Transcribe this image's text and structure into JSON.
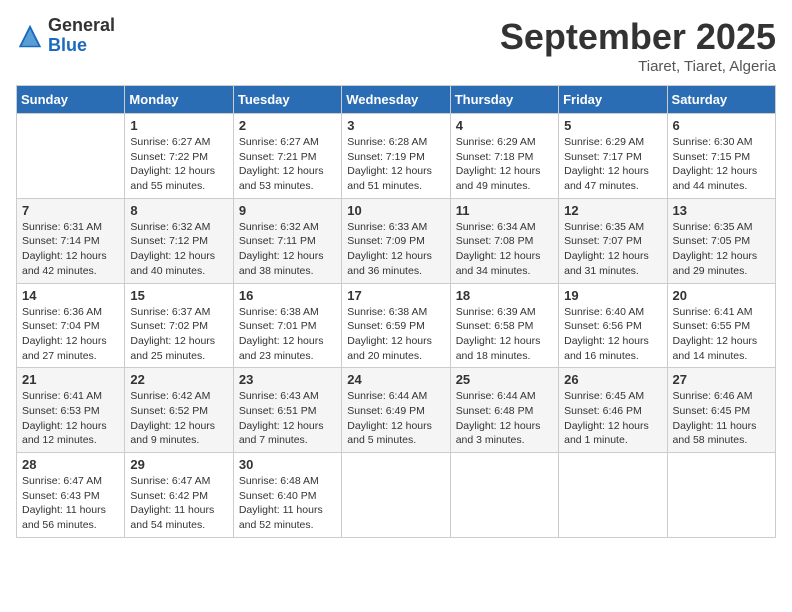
{
  "logo": {
    "general": "General",
    "blue": "Blue"
  },
  "title": "September 2025",
  "subtitle": "Tiaret, Tiaret, Algeria",
  "days_of_week": [
    "Sunday",
    "Monday",
    "Tuesday",
    "Wednesday",
    "Thursday",
    "Friday",
    "Saturday"
  ],
  "weeks": [
    [
      {
        "day": "",
        "info": ""
      },
      {
        "day": "1",
        "info": "Sunrise: 6:27 AM\nSunset: 7:22 PM\nDaylight: 12 hours\nand 55 minutes."
      },
      {
        "day": "2",
        "info": "Sunrise: 6:27 AM\nSunset: 7:21 PM\nDaylight: 12 hours\nand 53 minutes."
      },
      {
        "day": "3",
        "info": "Sunrise: 6:28 AM\nSunset: 7:19 PM\nDaylight: 12 hours\nand 51 minutes."
      },
      {
        "day": "4",
        "info": "Sunrise: 6:29 AM\nSunset: 7:18 PM\nDaylight: 12 hours\nand 49 minutes."
      },
      {
        "day": "5",
        "info": "Sunrise: 6:29 AM\nSunset: 7:17 PM\nDaylight: 12 hours\nand 47 minutes."
      },
      {
        "day": "6",
        "info": "Sunrise: 6:30 AM\nSunset: 7:15 PM\nDaylight: 12 hours\nand 44 minutes."
      }
    ],
    [
      {
        "day": "7",
        "info": "Sunrise: 6:31 AM\nSunset: 7:14 PM\nDaylight: 12 hours\nand 42 minutes."
      },
      {
        "day": "8",
        "info": "Sunrise: 6:32 AM\nSunset: 7:12 PM\nDaylight: 12 hours\nand 40 minutes."
      },
      {
        "day": "9",
        "info": "Sunrise: 6:32 AM\nSunset: 7:11 PM\nDaylight: 12 hours\nand 38 minutes."
      },
      {
        "day": "10",
        "info": "Sunrise: 6:33 AM\nSunset: 7:09 PM\nDaylight: 12 hours\nand 36 minutes."
      },
      {
        "day": "11",
        "info": "Sunrise: 6:34 AM\nSunset: 7:08 PM\nDaylight: 12 hours\nand 34 minutes."
      },
      {
        "day": "12",
        "info": "Sunrise: 6:35 AM\nSunset: 7:07 PM\nDaylight: 12 hours\nand 31 minutes."
      },
      {
        "day": "13",
        "info": "Sunrise: 6:35 AM\nSunset: 7:05 PM\nDaylight: 12 hours\nand 29 minutes."
      }
    ],
    [
      {
        "day": "14",
        "info": "Sunrise: 6:36 AM\nSunset: 7:04 PM\nDaylight: 12 hours\nand 27 minutes."
      },
      {
        "day": "15",
        "info": "Sunrise: 6:37 AM\nSunset: 7:02 PM\nDaylight: 12 hours\nand 25 minutes."
      },
      {
        "day": "16",
        "info": "Sunrise: 6:38 AM\nSunset: 7:01 PM\nDaylight: 12 hours\nand 23 minutes."
      },
      {
        "day": "17",
        "info": "Sunrise: 6:38 AM\nSunset: 6:59 PM\nDaylight: 12 hours\nand 20 minutes."
      },
      {
        "day": "18",
        "info": "Sunrise: 6:39 AM\nSunset: 6:58 PM\nDaylight: 12 hours\nand 18 minutes."
      },
      {
        "day": "19",
        "info": "Sunrise: 6:40 AM\nSunset: 6:56 PM\nDaylight: 12 hours\nand 16 minutes."
      },
      {
        "day": "20",
        "info": "Sunrise: 6:41 AM\nSunset: 6:55 PM\nDaylight: 12 hours\nand 14 minutes."
      }
    ],
    [
      {
        "day": "21",
        "info": "Sunrise: 6:41 AM\nSunset: 6:53 PM\nDaylight: 12 hours\nand 12 minutes."
      },
      {
        "day": "22",
        "info": "Sunrise: 6:42 AM\nSunset: 6:52 PM\nDaylight: 12 hours\nand 9 minutes."
      },
      {
        "day": "23",
        "info": "Sunrise: 6:43 AM\nSunset: 6:51 PM\nDaylight: 12 hours\nand 7 minutes."
      },
      {
        "day": "24",
        "info": "Sunrise: 6:44 AM\nSunset: 6:49 PM\nDaylight: 12 hours\nand 5 minutes."
      },
      {
        "day": "25",
        "info": "Sunrise: 6:44 AM\nSunset: 6:48 PM\nDaylight: 12 hours\nand 3 minutes."
      },
      {
        "day": "26",
        "info": "Sunrise: 6:45 AM\nSunset: 6:46 PM\nDaylight: 12 hours\nand 1 minute."
      },
      {
        "day": "27",
        "info": "Sunrise: 6:46 AM\nSunset: 6:45 PM\nDaylight: 11 hours\nand 58 minutes."
      }
    ],
    [
      {
        "day": "28",
        "info": "Sunrise: 6:47 AM\nSunset: 6:43 PM\nDaylight: 11 hours\nand 56 minutes."
      },
      {
        "day": "29",
        "info": "Sunrise: 6:47 AM\nSunset: 6:42 PM\nDaylight: 11 hours\nand 54 minutes."
      },
      {
        "day": "30",
        "info": "Sunrise: 6:48 AM\nSunset: 6:40 PM\nDaylight: 11 hours\nand 52 minutes."
      },
      {
        "day": "",
        "info": ""
      },
      {
        "day": "",
        "info": ""
      },
      {
        "day": "",
        "info": ""
      },
      {
        "day": "",
        "info": ""
      }
    ]
  ]
}
